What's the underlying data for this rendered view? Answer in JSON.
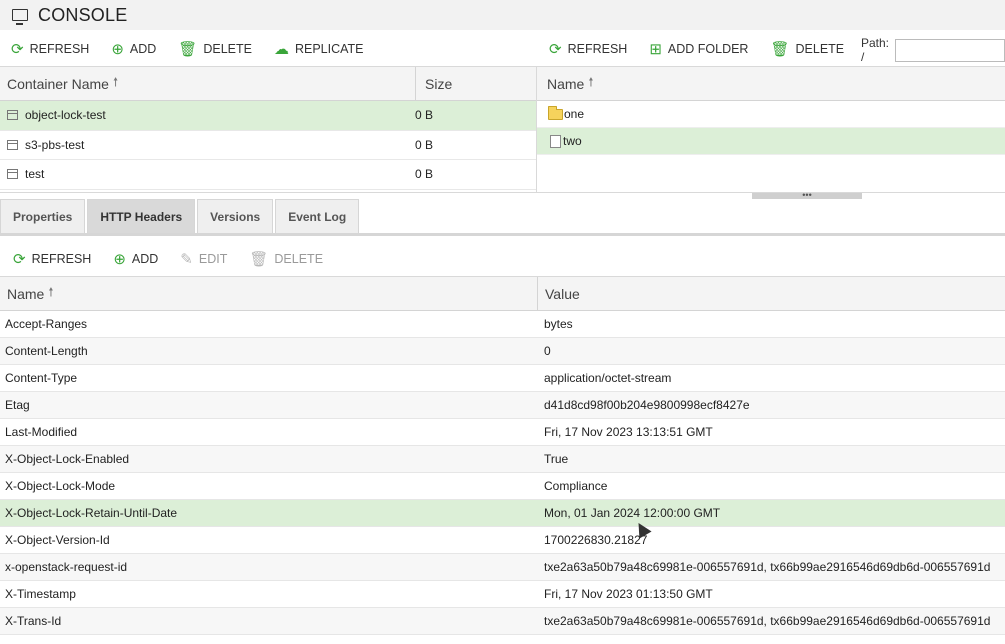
{
  "app": {
    "title": "CONSOLE"
  },
  "left_toolbar": {
    "refresh": "REFRESH",
    "add": "ADD",
    "delete": "DELETE",
    "replicate": "REPLICATE"
  },
  "right_toolbar": {
    "refresh": "REFRESH",
    "add_folder": "ADD FOLDER",
    "delete": "DELETE",
    "path_label": "Path: /",
    "path_value": ""
  },
  "containers": {
    "headers": {
      "name": "Container Name",
      "size": "Size"
    },
    "rows": [
      {
        "name": "object-lock-test",
        "size": "0 B"
      },
      {
        "name": "s3-pbs-test",
        "size": "0 B"
      },
      {
        "name": "test",
        "size": "0 B"
      }
    ]
  },
  "objects": {
    "header": "Name",
    "rows": [
      {
        "name": "one",
        "type": "folder-icon"
      },
      {
        "name": "two",
        "type": "file-icon"
      }
    ]
  },
  "tabs": [
    "Properties",
    "HTTP Headers",
    "Versions",
    "Event Log"
  ],
  "headers_toolbar": {
    "refresh": "REFRESH",
    "add": "ADD",
    "edit": "EDIT",
    "delete": "DELETE"
  },
  "http_headers": {
    "columns": {
      "name": "Name",
      "value": "Value"
    },
    "rows": [
      {
        "name": "Accept-Ranges",
        "value": "bytes"
      },
      {
        "name": "Content-Length",
        "value": "0"
      },
      {
        "name": "Content-Type",
        "value": "application/octet-stream"
      },
      {
        "name": "Etag",
        "value": "d41d8cd98f00b204e9800998ecf8427e"
      },
      {
        "name": "Last-Modified",
        "value": "Fri, 17 Nov 2023 13:13:51 GMT"
      },
      {
        "name": "X-Object-Lock-Enabled",
        "value": "True"
      },
      {
        "name": "X-Object-Lock-Mode",
        "value": "Compliance"
      },
      {
        "name": "X-Object-Lock-Retain-Until-Date",
        "value": "Mon, 01 Jan 2024 12:00:00 GMT"
      },
      {
        "name": "X-Object-Version-Id",
        "value": "1700226830.21827"
      },
      {
        "name": "x-openstack-request-id",
        "value": "txe2a63a50b79a48c69981e-006557691d, tx66b99ae2916546d69db6d-006557691d"
      },
      {
        "name": "X-Timestamp",
        "value": "Fri, 17 Nov 2023 01:13:50 GMT"
      },
      {
        "name": "X-Trans-Id",
        "value": "txe2a63a50b79a48c69981e-006557691d, tx66b99ae2916546d69db6d-006557691d"
      }
    ]
  },
  "colors": {
    "accent_green": "#3aa53a",
    "selection": "#dcefd7"
  }
}
